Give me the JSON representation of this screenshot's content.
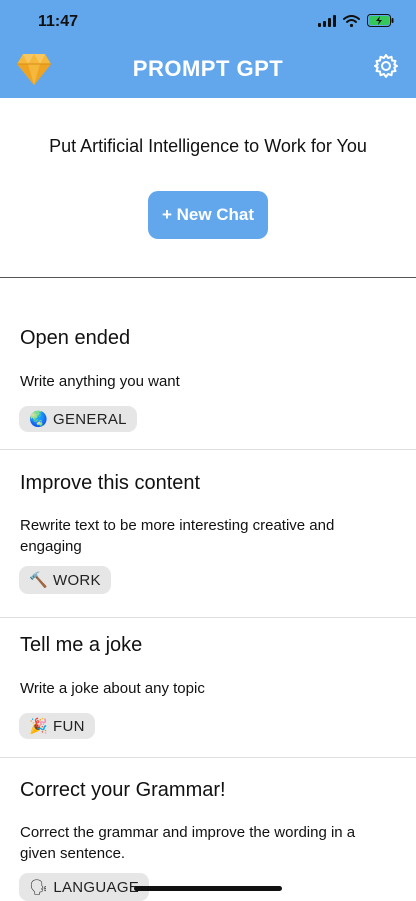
{
  "status": {
    "time": "11:47"
  },
  "header": {
    "title": "PROMPT GPT",
    "logo_icon": "diamond-icon",
    "settings_icon": "gear-icon"
  },
  "hero": {
    "tagline": "Put Artificial Intelligence to Work for You",
    "new_chat_label": "+ New Chat"
  },
  "prompts": [
    {
      "title": "Open ended",
      "description": "Write anything you want",
      "tag_emoji": "🌏",
      "tag_label": "GENERAL"
    },
    {
      "title": "Improve this content",
      "description": "Rewrite text to be more interesting creative and engaging",
      "tag_emoji": "🔨",
      "tag_label": "WORK"
    },
    {
      "title": "Tell me a joke",
      "description": "Write a joke about any topic",
      "tag_emoji": "🎉",
      "tag_label": "FUN"
    },
    {
      "title": "Correct your Grammar!",
      "description": "Correct the grammar and improve the wording in a given sentence.",
      "tag_emoji": "🗣",
      "tag_label": "LANGUAGE"
    }
  ],
  "colors": {
    "accent": "#62a7ec",
    "tag_bg": "#e6e6e6",
    "logo": "#f5b83a"
  }
}
